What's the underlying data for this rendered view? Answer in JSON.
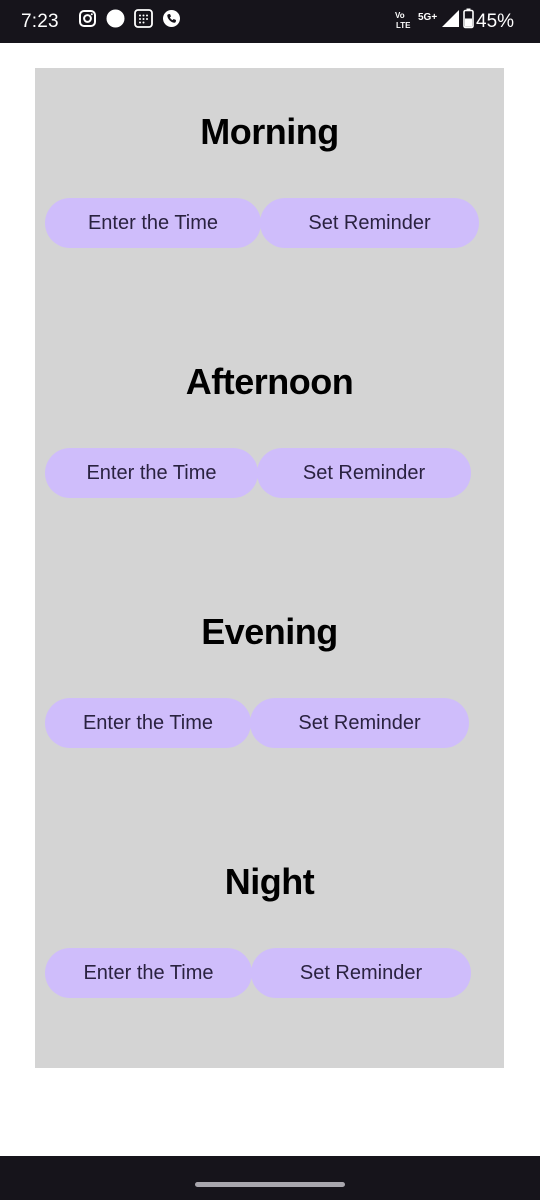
{
  "status_bar": {
    "time": "7:23",
    "network_top": "Vo",
    "network_bottom": "LTE",
    "network_type": "5G+",
    "battery": "45%",
    "icons": [
      "instagram-icon",
      "circle-icon",
      "calendar-icon",
      "phone-icon",
      "wifi-calling-icon",
      "signal-icon",
      "battery-icon"
    ]
  },
  "sections": [
    {
      "title": "Morning",
      "enter_label": "Enter the Time",
      "reminder_label": "Set Reminder"
    },
    {
      "title": "Afternoon",
      "enter_label": "Enter the Time",
      "reminder_label": "Set Reminder"
    },
    {
      "title": "Evening",
      "enter_label": "Enter the Time",
      "reminder_label": "Set Reminder"
    },
    {
      "title": "Night",
      "enter_label": "Enter the Time",
      "reminder_label": "Set Reminder"
    }
  ],
  "colors": {
    "status_bar_bg": "#16141b",
    "card_bg": "#d4d4d4",
    "button_bg": "#cfbdfb",
    "button_text": "#2a2240"
  }
}
